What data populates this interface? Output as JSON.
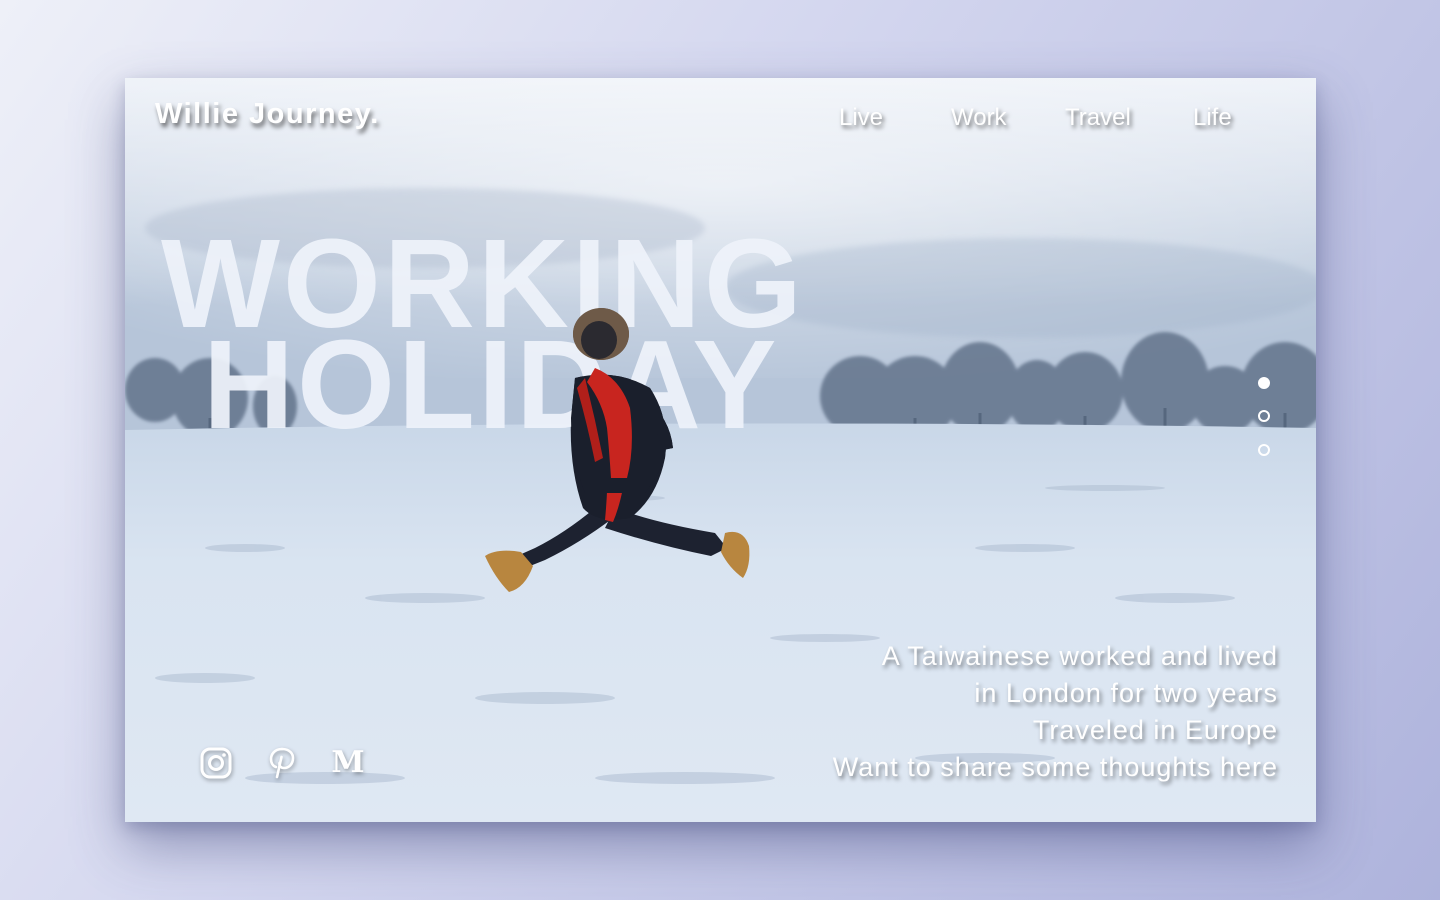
{
  "brand": {
    "name": "Willie Journey."
  },
  "nav": {
    "items": [
      {
        "label": "Live"
      },
      {
        "label": "Work"
      },
      {
        "label": "Travel"
      },
      {
        "label": "Life"
      }
    ]
  },
  "hero": {
    "title_line1": "WORKING",
    "title_line2": "HOLIDAY",
    "photo": "person-jumping-in-snowy-park-icon"
  },
  "tagline": {
    "lines": [
      "A Taiwainese worked and lived",
      "in London for two years",
      "Traveled in Europe",
      "Want to share some thoughts here"
    ]
  },
  "pagination": {
    "total": 3,
    "active": 1
  },
  "social": {
    "icons": [
      "instagram-icon",
      "pinterest-icon",
      "medium-icon"
    ],
    "medium_glyph": "M"
  },
  "colors": {
    "accent_scarf": "#c8251f",
    "snow": "#e3ecf6",
    "sky": "#c4d2e4",
    "text": "#ffffff"
  }
}
